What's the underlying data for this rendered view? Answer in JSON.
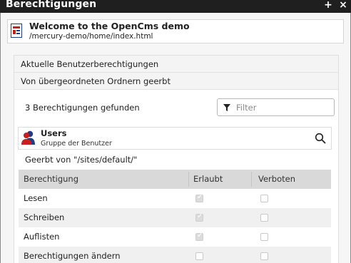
{
  "window": {
    "title": "Berechtigungen",
    "plus_label": "+",
    "close_label": "×"
  },
  "resource": {
    "title": "Welcome to the OpenCms demo",
    "path": "/mercury-demo/home/index.html"
  },
  "sections": {
    "current": "Aktuelle Benutzerberechtigungen",
    "inherited": "Von übergeordneten Ordnern geerbt"
  },
  "results": {
    "count_text": "3 Berechtigungen gefunden"
  },
  "filter": {
    "placeholder": "Filter"
  },
  "principal": {
    "name": "Users",
    "type": "Gruppe der Benutzer"
  },
  "inherited_from": "Geerbt von \"/sites/default/\"",
  "table": {
    "headers": [
      "Berechtigung",
      "Erlaubt",
      "Verboten"
    ],
    "rows": [
      {
        "label": "Lesen",
        "allowed": true,
        "denied": false
      },
      {
        "label": "Schreiben",
        "allowed": true,
        "denied": false
      },
      {
        "label": "Auflisten",
        "allowed": true,
        "denied": false
      },
      {
        "label": "Berechtigungen ändern",
        "allowed": false,
        "denied": false
      }
    ]
  },
  "colors": {
    "titlebar": "#1f1f1f",
    "dialog_bg": "#f6f6f6",
    "table_header": "#d9d9d9",
    "icon_blue": "#1f3f82",
    "icon_red": "#c81e1e"
  }
}
